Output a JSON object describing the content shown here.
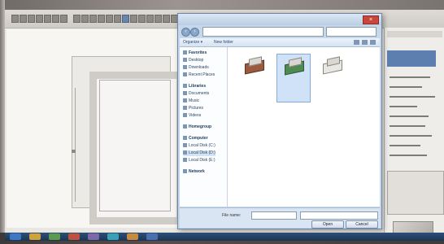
{
  "app": {
    "toolbar_icons": [
      "cursor-icon",
      "line-icon",
      "rect-icon",
      "circle-icon",
      "arc-icon",
      "move-icon",
      "rotate-icon",
      "copy-icon",
      "mirror-icon",
      "trim-icon",
      "extend-icon",
      "offset-icon",
      "dimension-icon",
      "text-icon",
      "hatch-icon",
      "layer-icon",
      "zoom-in-icon",
      "zoom-out-icon",
      "pan-icon",
      "render-icon"
    ]
  },
  "dialog": {
    "close_label": "×",
    "back_label": "‹",
    "forward_label": "›",
    "address": "",
    "organize_label": "Organize ▾",
    "new_folder_label": "New folder",
    "nav_items": [
      {
        "label": "Favorites",
        "group": true
      },
      {
        "label": "Desktop"
      },
      {
        "label": "Downloads"
      },
      {
        "label": "Recent Places"
      },
      {
        "label": "Libraries",
        "group": true
      },
      {
        "label": "Documents"
      },
      {
        "label": "Music"
      },
      {
        "label": "Pictures"
      },
      {
        "label": "Videos"
      },
      {
        "label": "Homegroup",
        "group": true
      },
      {
        "label": "Computer",
        "group": true
      },
      {
        "label": "Local Disk (C:)"
      },
      {
        "label": "Local Disk (D:)",
        "active": true
      },
      {
        "label": "Local Disk (E:)"
      },
      {
        "label": "Network",
        "group": true
      }
    ],
    "files": [
      {
        "name": "",
        "style": "brown"
      },
      {
        "name": "",
        "style": "green"
      },
      {
        "name": "",
        "style": "white"
      }
    ],
    "file_name_label": "File name:",
    "file_name_value": "",
    "file_type_value": "",
    "open_label": "Open",
    "cancel_label": "Cancel"
  },
  "colors": {
    "dialog_frame": "#c6d7ea",
    "selection": "#cfe2f7",
    "canvas": "#f7f6f3",
    "taskbar": "#1c3553"
  }
}
